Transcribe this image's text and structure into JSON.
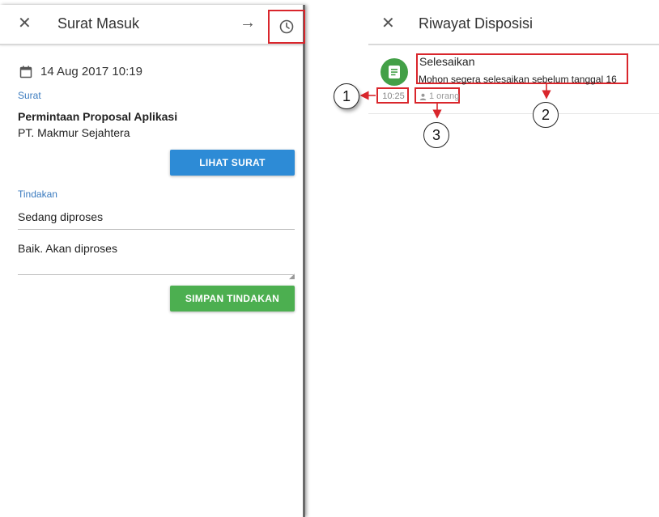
{
  "left": {
    "header": {
      "title": "Surat Masuk",
      "close_icon": "close-icon",
      "forward_icon": "arrow-right-icon",
      "history_icon": "clock-icon"
    },
    "date": "14 Aug 2017 10:19",
    "surat": {
      "label": "Surat",
      "subject": "Permintaan Proposal Aplikasi",
      "sender": "PT. Makmur Sejahtera",
      "view_button": "LIHAT SURAT"
    },
    "tindakan": {
      "label": "Tindakan",
      "status_value": "Sedang diproses",
      "note_value": "Baik. Akan diproses",
      "save_button": "SIMPAN TINDAKAN"
    }
  },
  "right": {
    "header": {
      "title": "Riwayat Disposisi",
      "close_icon": "close-icon"
    },
    "entry": {
      "title": "Selesaikan",
      "message": "Mohon segera selesaikan sebelum tanggal 16",
      "time": "10:25",
      "people": "1 orang",
      "avatar_icon": "document-icon",
      "avatar_color": "#43a047"
    }
  },
  "annotations": {
    "callout_1": "1",
    "callout_2": "2",
    "callout_3": "3",
    "highlight_color": "#d9262c"
  },
  "colors": {
    "primary_blue": "#2d8bd6",
    "action_green": "#4caf50",
    "label_blue": "#3b7bbf"
  }
}
